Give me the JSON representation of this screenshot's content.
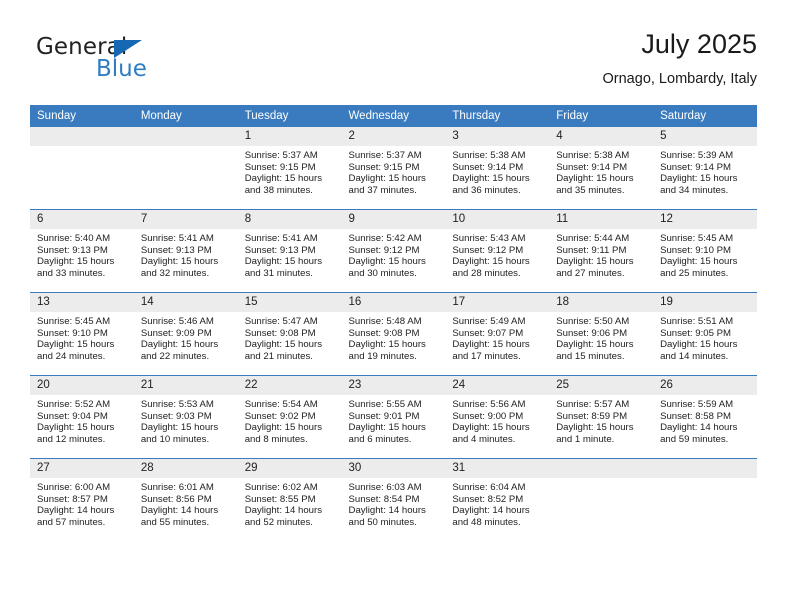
{
  "brand": {
    "name_part1": "General",
    "name_part2": "Blue",
    "triangle_color": "#1668b3",
    "blue_color": "#2f7ec4"
  },
  "header": {
    "title": "July 2025",
    "subtitle": "Ornago, Lombardy, Italy"
  },
  "theme": {
    "header_blue": "#3a7bbf",
    "daynum_band": "#ececec",
    "text": "#222222"
  },
  "weekday_headers": [
    "Sunday",
    "Monday",
    "Tuesday",
    "Wednesday",
    "Thursday",
    "Friday",
    "Saturday"
  ],
  "weeks": [
    [
      {
        "day": "",
        "empty": true
      },
      {
        "day": "",
        "empty": true
      },
      {
        "day": "1",
        "sunrise": "Sunrise: 5:37 AM",
        "sunset": "Sunset: 9:15 PM",
        "daylight_line1": "Daylight: 15 hours",
        "daylight_line2": "and 38 minutes."
      },
      {
        "day": "2",
        "sunrise": "Sunrise: 5:37 AM",
        "sunset": "Sunset: 9:15 PM",
        "daylight_line1": "Daylight: 15 hours",
        "daylight_line2": "and 37 minutes."
      },
      {
        "day": "3",
        "sunrise": "Sunrise: 5:38 AM",
        "sunset": "Sunset: 9:14 PM",
        "daylight_line1": "Daylight: 15 hours",
        "daylight_line2": "and 36 minutes."
      },
      {
        "day": "4",
        "sunrise": "Sunrise: 5:38 AM",
        "sunset": "Sunset: 9:14 PM",
        "daylight_line1": "Daylight: 15 hours",
        "daylight_line2": "and 35 minutes."
      },
      {
        "day": "5",
        "sunrise": "Sunrise: 5:39 AM",
        "sunset": "Sunset: 9:14 PM",
        "daylight_line1": "Daylight: 15 hours",
        "daylight_line2": "and 34 minutes."
      }
    ],
    [
      {
        "day": "6",
        "sunrise": "Sunrise: 5:40 AM",
        "sunset": "Sunset: 9:13 PM",
        "daylight_line1": "Daylight: 15 hours",
        "daylight_line2": "and 33 minutes."
      },
      {
        "day": "7",
        "sunrise": "Sunrise: 5:41 AM",
        "sunset": "Sunset: 9:13 PM",
        "daylight_line1": "Daylight: 15 hours",
        "daylight_line2": "and 32 minutes."
      },
      {
        "day": "8",
        "sunrise": "Sunrise: 5:41 AM",
        "sunset": "Sunset: 9:13 PM",
        "daylight_line1": "Daylight: 15 hours",
        "daylight_line2": "and 31 minutes."
      },
      {
        "day": "9",
        "sunrise": "Sunrise: 5:42 AM",
        "sunset": "Sunset: 9:12 PM",
        "daylight_line1": "Daylight: 15 hours",
        "daylight_line2": "and 30 minutes."
      },
      {
        "day": "10",
        "sunrise": "Sunrise: 5:43 AM",
        "sunset": "Sunset: 9:12 PM",
        "daylight_line1": "Daylight: 15 hours",
        "daylight_line2": "and 28 minutes."
      },
      {
        "day": "11",
        "sunrise": "Sunrise: 5:44 AM",
        "sunset": "Sunset: 9:11 PM",
        "daylight_line1": "Daylight: 15 hours",
        "daylight_line2": "and 27 minutes."
      },
      {
        "day": "12",
        "sunrise": "Sunrise: 5:45 AM",
        "sunset": "Sunset: 9:10 PM",
        "daylight_line1": "Daylight: 15 hours",
        "daylight_line2": "and 25 minutes."
      }
    ],
    [
      {
        "day": "13",
        "sunrise": "Sunrise: 5:45 AM",
        "sunset": "Sunset: 9:10 PM",
        "daylight_line1": "Daylight: 15 hours",
        "daylight_line2": "and 24 minutes."
      },
      {
        "day": "14",
        "sunrise": "Sunrise: 5:46 AM",
        "sunset": "Sunset: 9:09 PM",
        "daylight_line1": "Daylight: 15 hours",
        "daylight_line2": "and 22 minutes."
      },
      {
        "day": "15",
        "sunrise": "Sunrise: 5:47 AM",
        "sunset": "Sunset: 9:08 PM",
        "daylight_line1": "Daylight: 15 hours",
        "daylight_line2": "and 21 minutes."
      },
      {
        "day": "16",
        "sunrise": "Sunrise: 5:48 AM",
        "sunset": "Sunset: 9:08 PM",
        "daylight_line1": "Daylight: 15 hours",
        "daylight_line2": "and 19 minutes."
      },
      {
        "day": "17",
        "sunrise": "Sunrise: 5:49 AM",
        "sunset": "Sunset: 9:07 PM",
        "daylight_line1": "Daylight: 15 hours",
        "daylight_line2": "and 17 minutes."
      },
      {
        "day": "18",
        "sunrise": "Sunrise: 5:50 AM",
        "sunset": "Sunset: 9:06 PM",
        "daylight_line1": "Daylight: 15 hours",
        "daylight_line2": "and 15 minutes."
      },
      {
        "day": "19",
        "sunrise": "Sunrise: 5:51 AM",
        "sunset": "Sunset: 9:05 PM",
        "daylight_line1": "Daylight: 15 hours",
        "daylight_line2": "and 14 minutes."
      }
    ],
    [
      {
        "day": "20",
        "sunrise": "Sunrise: 5:52 AM",
        "sunset": "Sunset: 9:04 PM",
        "daylight_line1": "Daylight: 15 hours",
        "daylight_line2": "and 12 minutes."
      },
      {
        "day": "21",
        "sunrise": "Sunrise: 5:53 AM",
        "sunset": "Sunset: 9:03 PM",
        "daylight_line1": "Daylight: 15 hours",
        "daylight_line2": "and 10 minutes."
      },
      {
        "day": "22",
        "sunrise": "Sunrise: 5:54 AM",
        "sunset": "Sunset: 9:02 PM",
        "daylight_line1": "Daylight: 15 hours",
        "daylight_line2": "and 8 minutes."
      },
      {
        "day": "23",
        "sunrise": "Sunrise: 5:55 AM",
        "sunset": "Sunset: 9:01 PM",
        "daylight_line1": "Daylight: 15 hours",
        "daylight_line2": "and 6 minutes."
      },
      {
        "day": "24",
        "sunrise": "Sunrise: 5:56 AM",
        "sunset": "Sunset: 9:00 PM",
        "daylight_line1": "Daylight: 15 hours",
        "daylight_line2": "and 4 minutes."
      },
      {
        "day": "25",
        "sunrise": "Sunrise: 5:57 AM",
        "sunset": "Sunset: 8:59 PM",
        "daylight_line1": "Daylight: 15 hours",
        "daylight_line2": "and 1 minute."
      },
      {
        "day": "26",
        "sunrise": "Sunrise: 5:59 AM",
        "sunset": "Sunset: 8:58 PM",
        "daylight_line1": "Daylight: 14 hours",
        "daylight_line2": "and 59 minutes."
      }
    ],
    [
      {
        "day": "27",
        "sunrise": "Sunrise: 6:00 AM",
        "sunset": "Sunset: 8:57 PM",
        "daylight_line1": "Daylight: 14 hours",
        "daylight_line2": "and 57 minutes."
      },
      {
        "day": "28",
        "sunrise": "Sunrise: 6:01 AM",
        "sunset": "Sunset: 8:56 PM",
        "daylight_line1": "Daylight: 14 hours",
        "daylight_line2": "and 55 minutes."
      },
      {
        "day": "29",
        "sunrise": "Sunrise: 6:02 AM",
        "sunset": "Sunset: 8:55 PM",
        "daylight_line1": "Daylight: 14 hours",
        "daylight_line2": "and 52 minutes."
      },
      {
        "day": "30",
        "sunrise": "Sunrise: 6:03 AM",
        "sunset": "Sunset: 8:54 PM",
        "daylight_line1": "Daylight: 14 hours",
        "daylight_line2": "and 50 minutes."
      },
      {
        "day": "31",
        "sunrise": "Sunrise: 6:04 AM",
        "sunset": "Sunset: 8:52 PM",
        "daylight_line1": "Daylight: 14 hours",
        "daylight_line2": "and 48 minutes."
      },
      {
        "day": "",
        "empty": true
      },
      {
        "day": "",
        "empty": true
      }
    ]
  ]
}
